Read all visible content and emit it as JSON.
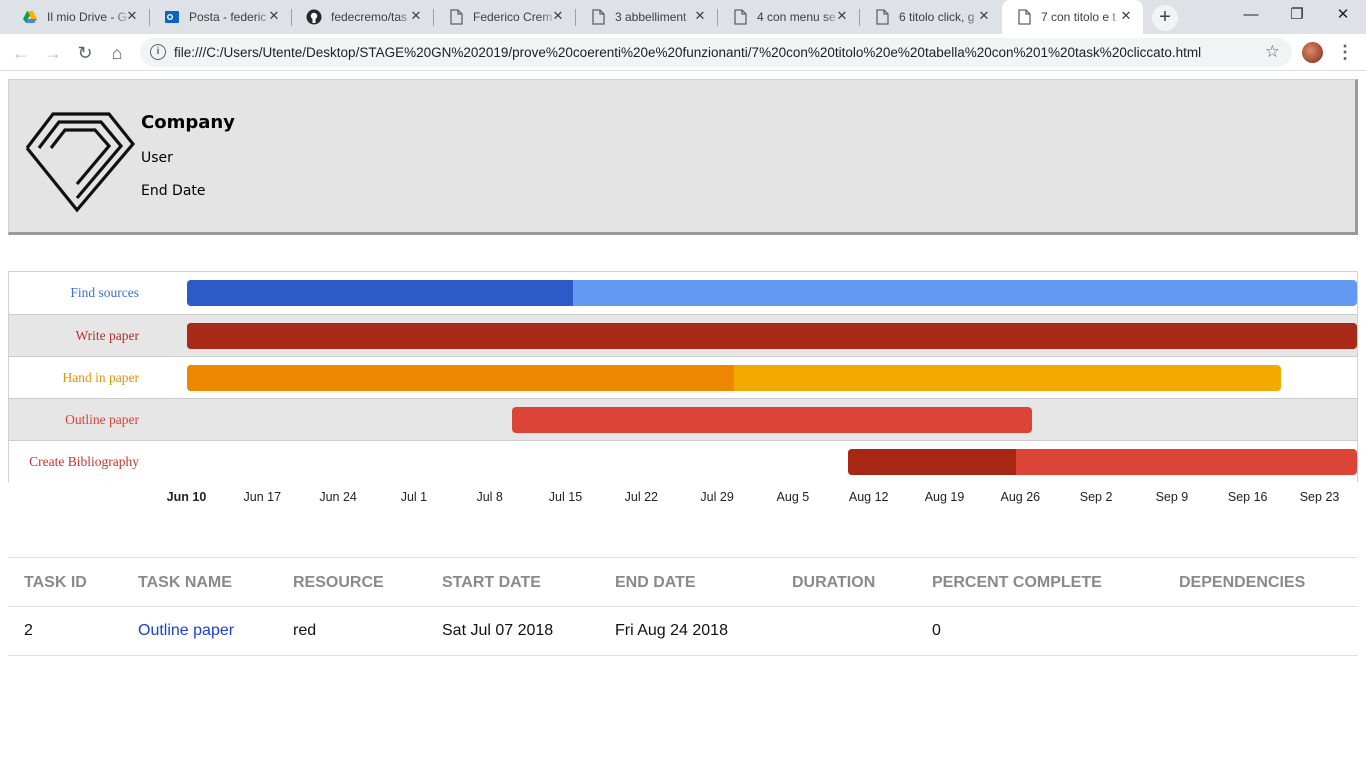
{
  "browser": {
    "tabs": [
      {
        "title": "Il mio Drive - G",
        "icon": "google-drive-icon",
        "active": false
      },
      {
        "title": "Posta - federic",
        "icon": "outlook-icon",
        "active": false
      },
      {
        "title": "fedecremo/tas",
        "icon": "github-icon",
        "active": false
      },
      {
        "title": "Federico Crem",
        "icon": "document-icon",
        "active": false
      },
      {
        "title": "3 abbelliment",
        "icon": "document-icon",
        "active": false
      },
      {
        "title": "4 con menu se",
        "icon": "document-icon",
        "active": false
      },
      {
        "title": "6 titolo click, g",
        "icon": "document-icon",
        "active": false
      },
      {
        "title": "7 con titolo e t",
        "icon": "document-icon",
        "active": true
      }
    ],
    "new_tab": "+",
    "controls": {
      "minimize": "—",
      "restore": "❐",
      "close": "✕"
    },
    "nav": {
      "back": "←",
      "forward": "→",
      "reload": "↻",
      "home": "⌂"
    },
    "url": "file:///C:/Users/Utente/Desktop/STAGE%20GN%202019/prove%20coerenti%20e%20funzionanti/7%20con%20titolo%20e%20tabella%20con%201%20task%20cliccato.html",
    "bookmark_star": "☆",
    "menu": "⋮"
  },
  "header": {
    "company": "Company",
    "user": "User",
    "end_date": "End Date"
  },
  "gantt": {
    "rows": [
      {
        "label": "Find sources",
        "label_color": "#3c6fd6",
        "start": "2018-06-10",
        "end": "2018-09-26",
        "percent": 33,
        "done_color": "#2c5bc8",
        "rest_color": "#6399f2"
      },
      {
        "label": "Write paper",
        "label_color": "#b8312a",
        "start": "2018-06-10",
        "end": "2018-09-26",
        "percent": 100,
        "done_color": "#a92918",
        "rest_color": "#a92918"
      },
      {
        "label": "Hand in paper",
        "label_color": "#e59400",
        "start": "2018-06-10",
        "end": "2018-09-19",
        "percent": 50,
        "done_color": "#ee8700",
        "rest_color": "#f3a900"
      },
      {
        "label": "Outline paper",
        "label_color": "#d64535",
        "start": "2018-07-10",
        "end": "2018-08-27",
        "percent": 0,
        "done_color": "#db4437",
        "rest_color": "#db4437"
      },
      {
        "label": "Create Bibliography",
        "label_color": "#c6342b",
        "start": "2018-08-10",
        "end": "2018-09-26",
        "percent": 33,
        "done_color": "#a52714",
        "rest_color": "#db4437"
      }
    ],
    "axis": [
      {
        "label": "Jun 10",
        "date": "2018-06-10",
        "bold": true
      },
      {
        "label": "Jun 17",
        "date": "2018-06-17"
      },
      {
        "label": "Jun 24",
        "date": "2018-06-24"
      },
      {
        "label": "Jul 1",
        "date": "2018-07-01"
      },
      {
        "label": "Jul 8",
        "date": "2018-07-08"
      },
      {
        "label": "Jul 15",
        "date": "2018-07-15"
      },
      {
        "label": "Jul 22",
        "date": "2018-07-22"
      },
      {
        "label": "Jul 29",
        "date": "2018-07-29"
      },
      {
        "label": "Aug 5",
        "date": "2018-08-05"
      },
      {
        "label": "Aug 12",
        "date": "2018-08-12"
      },
      {
        "label": "Aug 19",
        "date": "2018-08-19"
      },
      {
        "label": "Aug 26",
        "date": "2018-08-26"
      },
      {
        "label": "Sep 2",
        "date": "2018-09-02"
      },
      {
        "label": "Sep 9",
        "date": "2018-09-09"
      },
      {
        "label": "Sep 16",
        "date": "2018-09-16"
      },
      {
        "label": "Sep 23",
        "date": "2018-09-23"
      }
    ],
    "domain": [
      "2018-06-07",
      "2018-09-26"
    ]
  },
  "table": {
    "headers": [
      "TASK ID",
      "TASK NAME",
      "RESOURCE",
      "START DATE",
      "END DATE",
      "DURATION",
      "PERCENT COMPLETE",
      "DEPENDENCIES"
    ],
    "rows": [
      [
        "2",
        "Outline paper",
        "red",
        "Sat Jul 07 2018",
        "Fri Aug 24 2018",
        "",
        "0",
        ""
      ]
    ]
  }
}
